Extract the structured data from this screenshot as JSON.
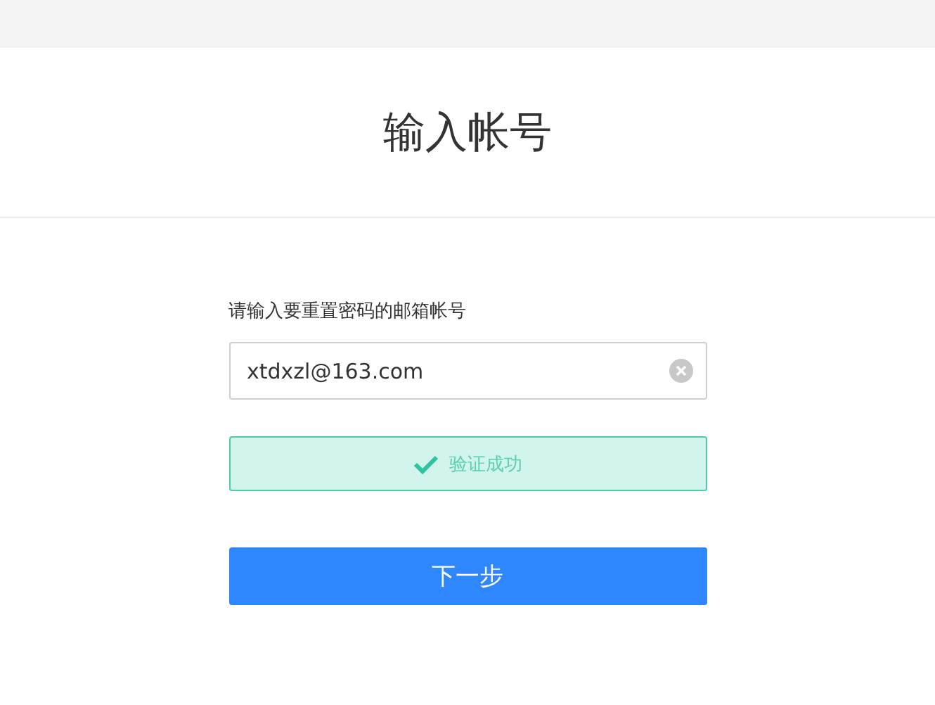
{
  "title": "输入帐号",
  "form": {
    "label": "请输入要重置密码的邮箱帐号",
    "email": {
      "value": "xtdxzl@163.com"
    },
    "verification": {
      "verified": true,
      "message": "验证成功"
    },
    "next_button": "下一步"
  }
}
